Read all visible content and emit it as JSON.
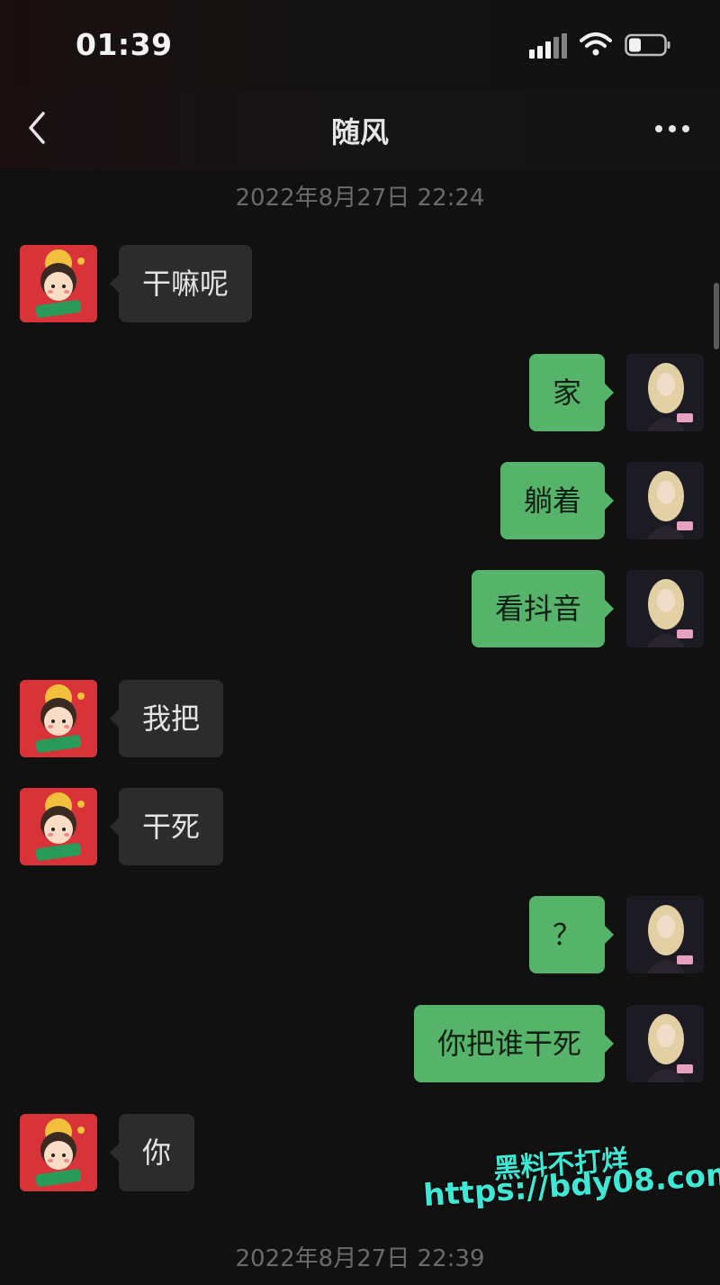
{
  "status_bar": {
    "time": "01:39",
    "signal_icon": "signal-bars-icon",
    "wifi_icon": "wifi-icon",
    "battery_icon": "battery-icon",
    "battery_level": 0.35
  },
  "nav": {
    "title": "随风",
    "back_icon": "chevron-left-icon",
    "more_icon": "more-dots-icon"
  },
  "timestamps": {
    "first": "2022年8月27日 22:24",
    "second": "2022年8月27日 22:39"
  },
  "messages": [
    {
      "side": "in",
      "text": "干嘛呢"
    },
    {
      "side": "out",
      "text": "家"
    },
    {
      "side": "out",
      "text": "躺着"
    },
    {
      "side": "out",
      "text": "看抖音"
    },
    {
      "side": "in",
      "text": "我把"
    },
    {
      "side": "in",
      "text": "干死"
    },
    {
      "side": "out",
      "text": "？"
    },
    {
      "side": "out",
      "text": "你把谁干死"
    },
    {
      "side": "in",
      "text": "你"
    }
  ],
  "watermark": {
    "line1": "黑料不打烊",
    "line2": "https://bdy08.com"
  },
  "colors": {
    "background": "#111111",
    "incoming_bubble": "#2c2c2c",
    "outgoing_bubble": "#56b36a",
    "watermark": "#3ee8d4"
  }
}
